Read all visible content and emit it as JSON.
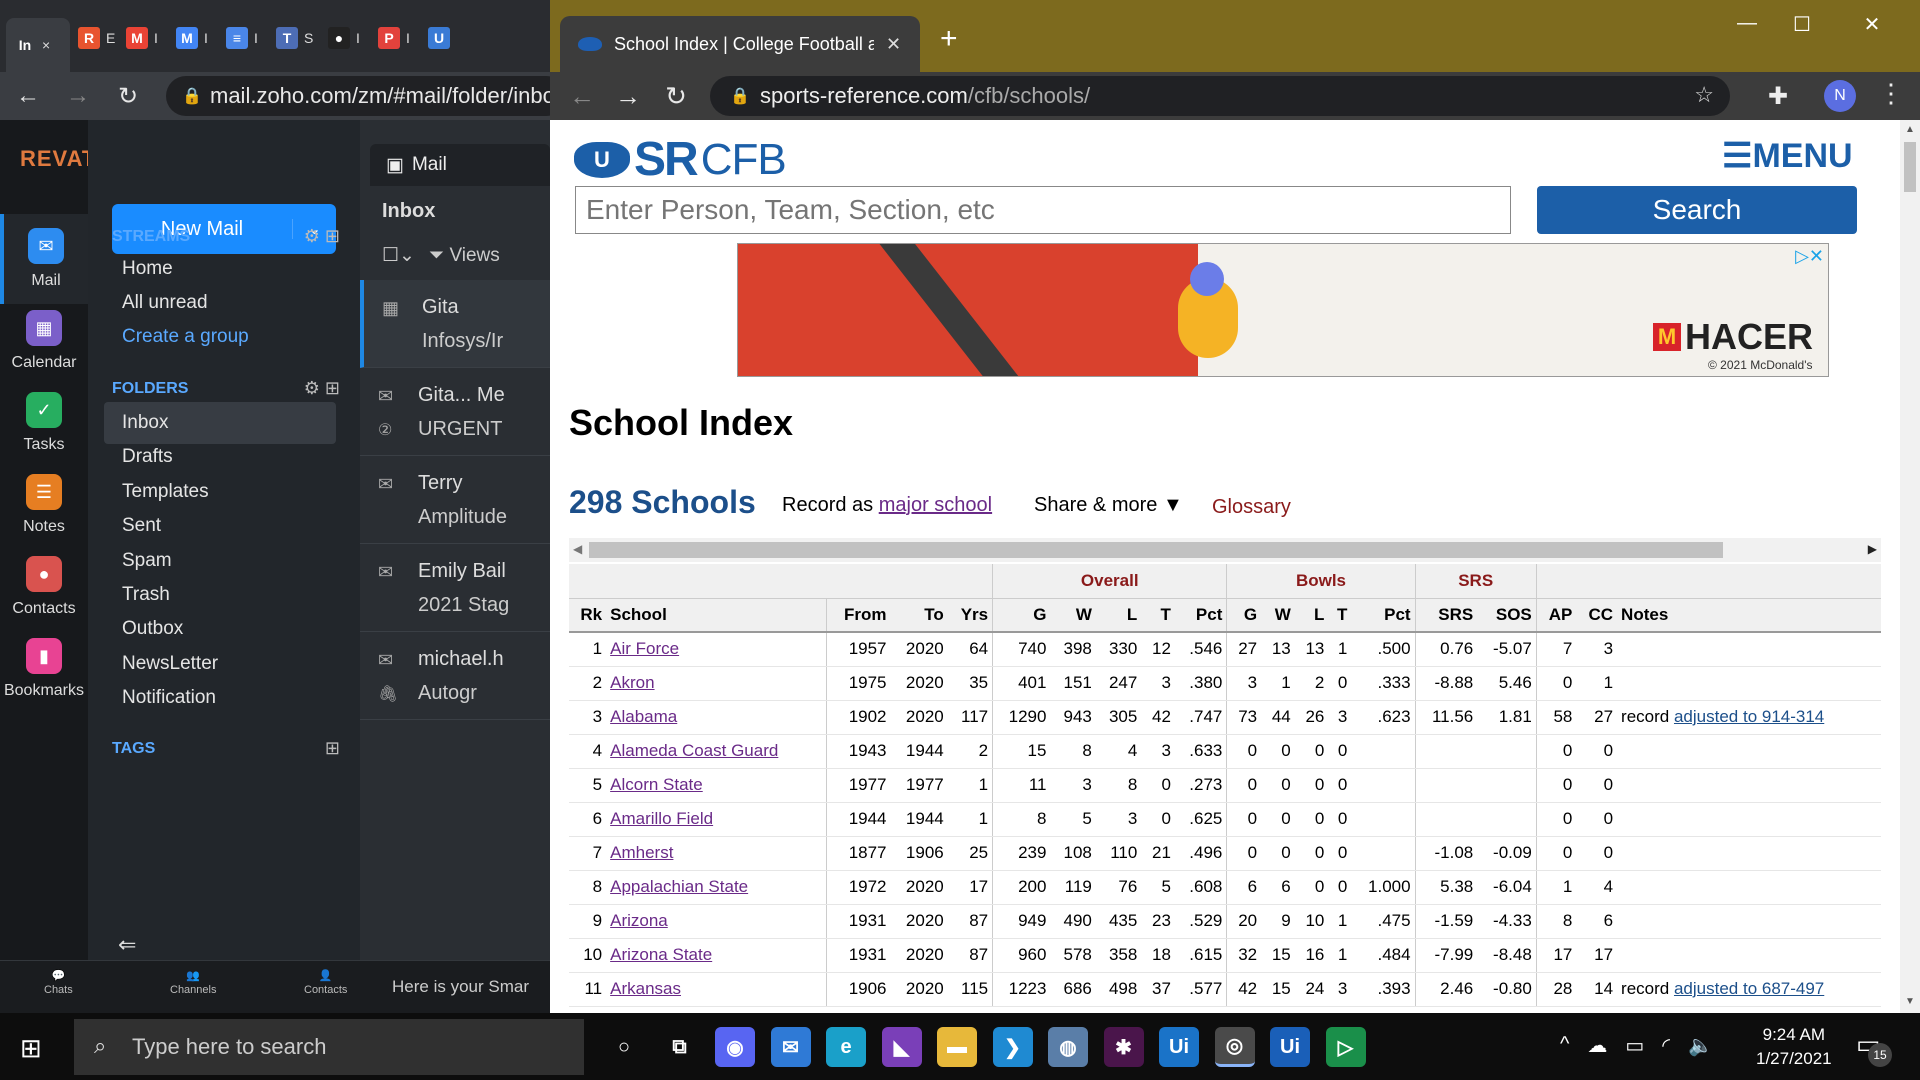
{
  "left_window": {
    "tabs": [
      {
        "fav": "In",
        "label": "×",
        "color": "#3a3d42"
      },
      {
        "fav": "R",
        "label": "E",
        "color": "#e8542f"
      },
      {
        "fav": "M",
        "label": "I",
        "color": "#ea4335"
      },
      {
        "fav": "M",
        "label": "I",
        "color": "#4285f4"
      },
      {
        "fav": "≡",
        "label": "I",
        "color": "#4a86e8"
      },
      {
        "fav": "T",
        "label": "S",
        "color": "#4d6db5"
      },
      {
        "fav": "●",
        "label": "I",
        "color": "#222222"
      },
      {
        "fav": "P",
        "label": "I",
        "color": "#e2423c"
      },
      {
        "fav": "U",
        "label": "",
        "color": "#3a7bd5"
      }
    ],
    "url": "mail.zoho.com/zm/#mail/folder/inbo",
    "brand": "REVATURE",
    "rail": [
      {
        "label": "Mail",
        "icon": "✉",
        "color": "#2d8cf0"
      },
      {
        "label": "Calendar",
        "icon": "▦",
        "color": "#7b5fc9"
      },
      {
        "label": "Tasks",
        "icon": "✓",
        "color": "#27ae60"
      },
      {
        "label": "Notes",
        "icon": "☰",
        "color": "#e67e22"
      },
      {
        "label": "Contacts",
        "icon": "●",
        "color": "#d9534f"
      },
      {
        "label": "Bookmarks",
        "icon": "▮",
        "color": "#e84393"
      }
    ],
    "new_mail": "New Mail",
    "streams_label": "STREAMS",
    "streams": [
      "Home",
      "All unread",
      "Create a group"
    ],
    "folders_label": "FOLDERS",
    "folders": [
      "Inbox",
      "Drafts",
      "Templates",
      "Sent",
      "Spam",
      "Trash",
      "Outbox",
      "NewsLetter",
      "Notification"
    ],
    "tags_label": "TAGS",
    "mail_tab": "Mail",
    "inbox_label": "Inbox",
    "views_label": "Views",
    "messages": [
      {
        "line1": "Gita",
        "line2": "Infosys/Ir",
        "icon": "▦",
        "icon2": ""
      },
      {
        "line1": "Gita... Me",
        "line2": "URGENT",
        "icon": "✉",
        "icon2": "②"
      },
      {
        "line1": "Terry",
        "line2": "Amplitude",
        "icon": "✉",
        "icon2": ""
      },
      {
        "line1": "Emily Bail",
        "line2": "2021 Stag",
        "icon": "✉",
        "icon2": ""
      },
      {
        "line1": "michael.h",
        "line2": "Autogr",
        "icon": "✉",
        "icon2": "🖇"
      }
    ],
    "bottom": {
      "chats": "Chats",
      "channels": "Channels",
      "contacts": "Contacts",
      "snippet": "Here is your Smar"
    }
  },
  "right_window": {
    "tab_title": "School Index | College Football a",
    "url_host": "sports-reference.com",
    "url_path": "/cfb/schools/",
    "avatar": "N",
    "site": {
      "logo_sr": "SR",
      "logo_cfb": "CFB",
      "menu": "☰MENU",
      "search_placeholder": "Enter Person, Team, Section, etc",
      "search_button": "Search"
    },
    "ad": {
      "brand": "HACER",
      "copyright": "© 2021 McDonald's"
    },
    "title": "School Index",
    "count": "298 Schools",
    "record_as_prefix": "Record as",
    "record_as_link": "major school",
    "share": "Share & more ▼",
    "glossary": "Glossary",
    "table": {
      "groups": {
        "overall": "Overall",
        "bowls": "Bowls",
        "srs": "SRS"
      },
      "columns": [
        "Rk",
        "School",
        "From",
        "To",
        "Yrs",
        "G",
        "W",
        "L",
        "T",
        "Pct",
        "G",
        "W",
        "L",
        "T",
        "Pct",
        "SRS",
        "SOS",
        "AP",
        "CC",
        "Notes"
      ],
      "rows": [
        [
          "1",
          "Air Force",
          "1957",
          "2020",
          "64",
          "740",
          "398",
          "330",
          "12",
          ".546",
          "27",
          "13",
          "13",
          "1",
          ".500",
          "0.76",
          "-5.07",
          "7",
          "3",
          "",
          ""
        ],
        [
          "2",
          "Akron",
          "1975",
          "2020",
          "35",
          "401",
          "151",
          "247",
          "3",
          ".380",
          "3",
          "1",
          "2",
          "0",
          ".333",
          "-8.88",
          "5.46",
          "0",
          "1",
          "",
          ""
        ],
        [
          "3",
          "Alabama",
          "1902",
          "2020",
          "117",
          "1290",
          "943",
          "305",
          "42",
          ".747",
          "73",
          "44",
          "26",
          "3",
          ".623",
          "11.56",
          "1.81",
          "58",
          "27",
          "record ",
          "adjusted to 914-314"
        ],
        [
          "4",
          "Alameda Coast Guard",
          "1943",
          "1944",
          "2",
          "15",
          "8",
          "4",
          "3",
          ".633",
          "0",
          "0",
          "0",
          "0",
          "",
          "",
          "",
          "0",
          "0",
          "",
          ""
        ],
        [
          "5",
          "Alcorn State",
          "1977",
          "1977",
          "1",
          "11",
          "3",
          "8",
          "0",
          ".273",
          "0",
          "0",
          "0",
          "0",
          "",
          "",
          "",
          "0",
          "0",
          "",
          ""
        ],
        [
          "6",
          "Amarillo Field",
          "1944",
          "1944",
          "1",
          "8",
          "5",
          "3",
          "0",
          ".625",
          "0",
          "0",
          "0",
          "0",
          "",
          "",
          "",
          "0",
          "0",
          "",
          ""
        ],
        [
          "7",
          "Amherst",
          "1877",
          "1906",
          "25",
          "239",
          "108",
          "110",
          "21",
          ".496",
          "0",
          "0",
          "0",
          "0",
          "",
          "-1.08",
          "-0.09",
          "0",
          "0",
          "",
          ""
        ],
        [
          "8",
          "Appalachian State",
          "1972",
          "2020",
          "17",
          "200",
          "119",
          "76",
          "5",
          ".608",
          "6",
          "6",
          "0",
          "0",
          "1.000",
          "5.38",
          "-6.04",
          "1",
          "4",
          "",
          ""
        ],
        [
          "9",
          "Arizona",
          "1931",
          "2020",
          "87",
          "949",
          "490",
          "435",
          "23",
          ".529",
          "20",
          "9",
          "10",
          "1",
          ".475",
          "-1.59",
          "-4.33",
          "8",
          "6",
          "",
          ""
        ],
        [
          "10",
          "Arizona State",
          "1931",
          "2020",
          "87",
          "960",
          "578",
          "358",
          "18",
          ".615",
          "32",
          "15",
          "16",
          "1",
          ".484",
          "-7.99",
          "-8.48",
          "17",
          "17",
          "",
          ""
        ],
        [
          "11",
          "Arkansas",
          "1906",
          "2020",
          "115",
          "1223",
          "686",
          "498",
          "37",
          ".577",
          "42",
          "15",
          "24",
          "3",
          ".393",
          "2.46",
          "-0.80",
          "28",
          "14",
          "record ",
          "adjusted to 687-497"
        ]
      ]
    }
  },
  "taskbar": {
    "search_placeholder": "Type here to search",
    "time": "9:24 AM",
    "date": "1/27/2021",
    "notif_count": "15",
    "apps": [
      {
        "name": "cortana-icon",
        "glyph": "○",
        "color": "transparent"
      },
      {
        "name": "task-view-icon",
        "glyph": "⧉",
        "color": "transparent"
      },
      {
        "name": "discord-icon",
        "glyph": "◉",
        "color": "#5865f2"
      },
      {
        "name": "mail-app-icon",
        "glyph": "✉",
        "color": "#2f7ad6"
      },
      {
        "name": "edge-icon",
        "glyph": "e",
        "color": "#1aa0c9"
      },
      {
        "name": "visual-studio-icon",
        "glyph": "◣",
        "color": "#7a3fb8"
      },
      {
        "name": "file-explorer-icon",
        "glyph": "▬",
        "color": "#e7b83a"
      },
      {
        "name": "vscode-icon",
        "glyph": "❯",
        "color": "#1f8ad2"
      },
      {
        "name": "postgres-icon",
        "glyph": "◍",
        "color": "#5a7ea8"
      },
      {
        "name": "slack-icon",
        "glyph": "✱",
        "color": "#4a154b"
      },
      {
        "name": "uipath-icon",
        "glyph": "Ui",
        "color": "#1a73c8"
      },
      {
        "name": "chrome-icon",
        "glyph": "◎",
        "color": "#4a4a4a"
      },
      {
        "name": "uipath-studio-icon",
        "glyph": "Ui",
        "color": "#1a5fb8"
      },
      {
        "name": "media-player-icon",
        "glyph": "▷",
        "color": "#1a8f4a"
      }
    ]
  }
}
